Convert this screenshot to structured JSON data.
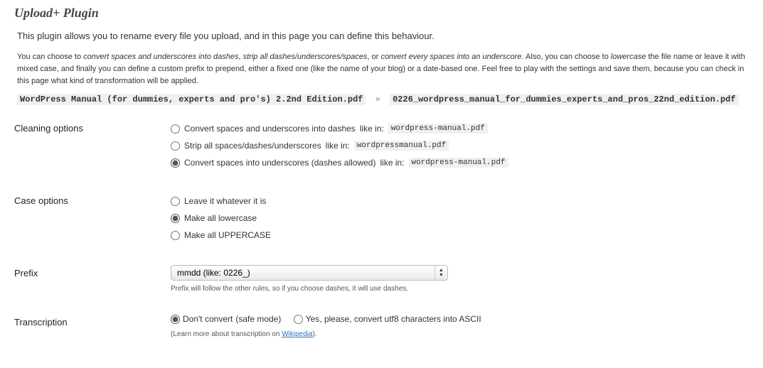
{
  "title": "Upload+ Plugin",
  "intro": "This plugin allows you to rename every file you upload, and in this page you can define this behaviour.",
  "desc": {
    "t1": "You can choose to ",
    "e1": "convert spaces and underscores into dashes",
    "t2": ", ",
    "e2": "strip all dashes/underscores/spaces",
    "t3": ", or ",
    "e3": "convert every spaces into an underscore",
    "t4": ". Also, you can choose to ",
    "e4": "lowercase",
    "t5": " the file name or leave it with mixed case, and finally you can define a custom prefix to prepend, either a fixed one (like the name of your blog) or a date-based one. Feel free to play with the settings and save them, because you can check in this page what kind of transformation will be applied."
  },
  "example": {
    "input": "WordPress Manual (for dummies, experts and pro's) 2.2nd Edition.pdf",
    "arrow": "»",
    "output": "0226_wordpress_manual_for_dummies_experts_and_pros_22nd_edition.pdf"
  },
  "cleaning": {
    "heading": "Cleaning options",
    "opt1": {
      "label": "Convert spaces and underscores into dashes",
      "like": "like in:",
      "code": "wordpress-manual.pdf"
    },
    "opt2": {
      "label": "Strip all spaces/dashes/underscores",
      "like": "like in:",
      "code": "wordpressmanual.pdf"
    },
    "opt3": {
      "label": "Convert spaces into underscores (dashes allowed)",
      "like": "like in:",
      "code": "wordpress-manual.pdf"
    }
  },
  "case": {
    "heading": "Case options",
    "opt1": "Leave it whatever it is",
    "opt2": "Make all lowercase",
    "opt3": "Make all UPPERCASE"
  },
  "prefix": {
    "heading": "Prefix",
    "selected": "mmdd (like: 0226_)",
    "note": "Prefix will follow the other rules, so if you choose dashes, it will use dashes."
  },
  "transcription": {
    "heading": "Transcription",
    "opt1": {
      "label": "Don't convert",
      "safe": "(safe mode)"
    },
    "opt2": "Yes, please, convert utf8 characters into ASCII",
    "note_pre": "(Learn more about transcription on ",
    "note_link": "Wikipedia",
    "note_post": ")."
  }
}
